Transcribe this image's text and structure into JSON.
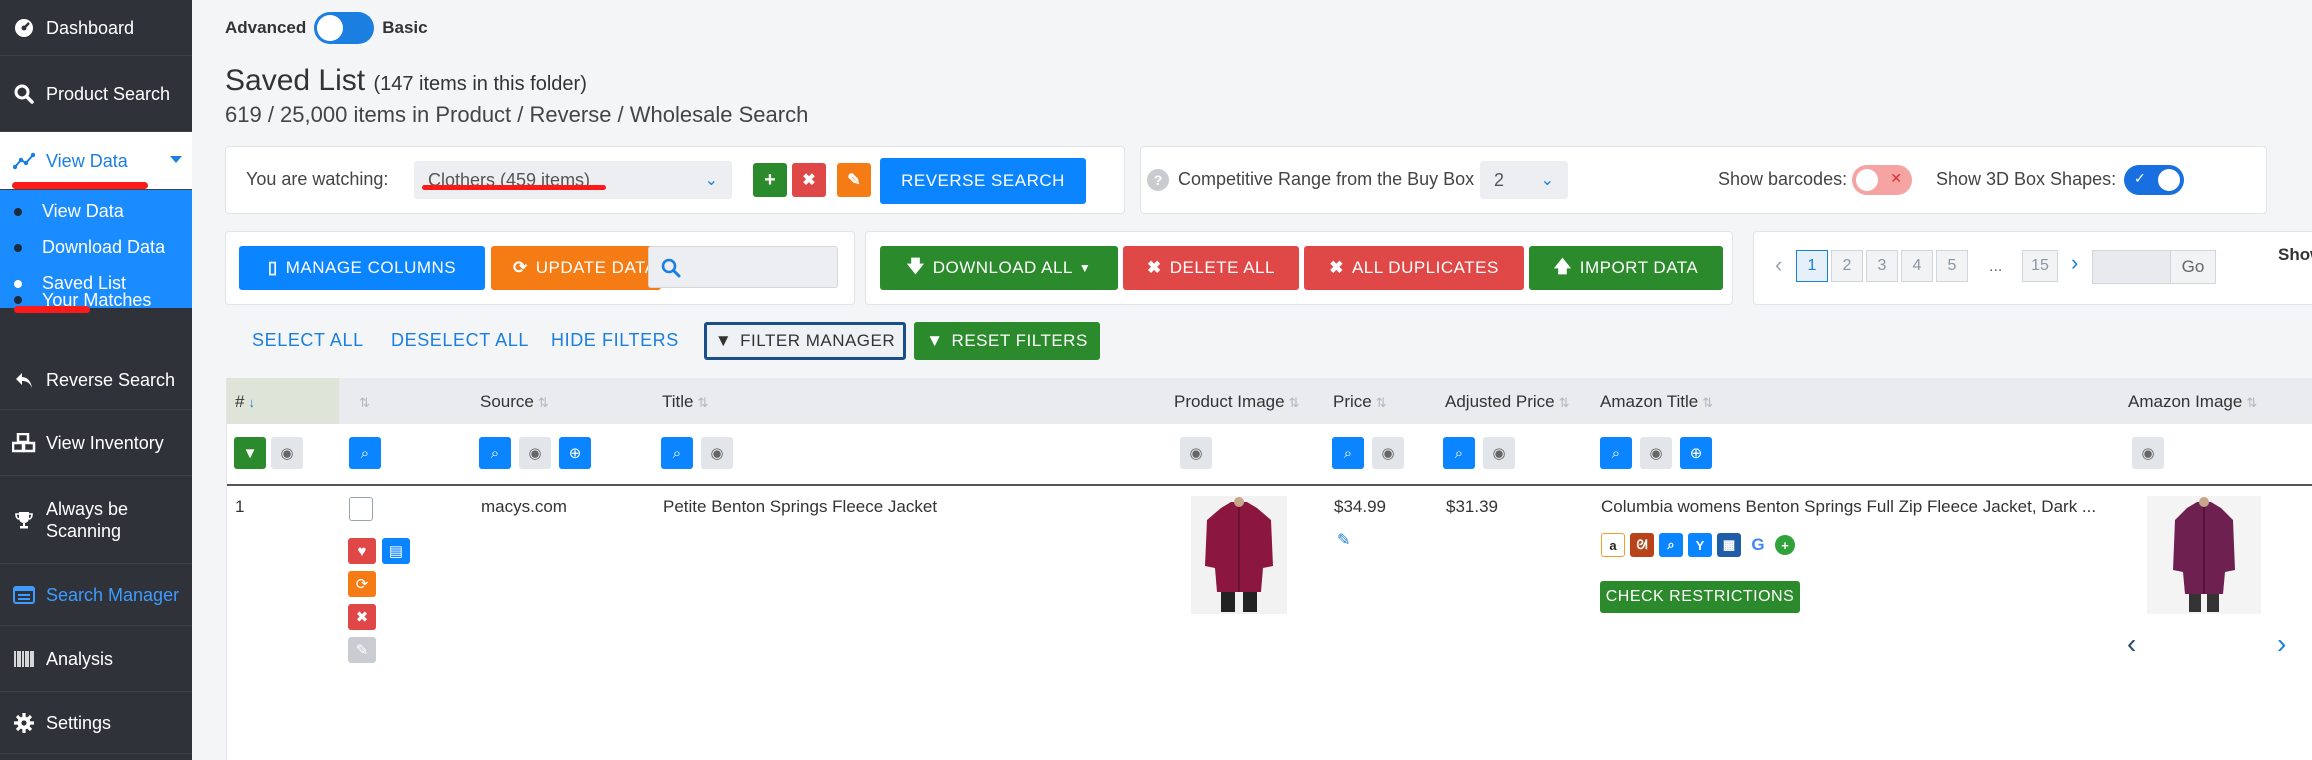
{
  "sidebar": {
    "items": [
      {
        "label": "Dashboard",
        "icon": "dashboard-icon"
      },
      {
        "label": "Product Search",
        "icon": "search-icon"
      },
      {
        "label": "View Data",
        "icon": "chart-line-icon"
      },
      {
        "label": "Reverse Search",
        "icon": "reply-icon"
      },
      {
        "label": "View Inventory",
        "icon": "boxes-icon"
      },
      {
        "label": "Always be Scanning",
        "icon": "trophy-icon"
      },
      {
        "label": "Search Manager",
        "icon": "list-window-icon"
      },
      {
        "label": "Analysis",
        "icon": "barcode-icon"
      },
      {
        "label": "Settings",
        "icon": "gear-icon"
      }
    ],
    "submenu": [
      "View Data",
      "Download Data",
      "Saved List",
      "Your Matches"
    ]
  },
  "mode_toggle": {
    "left": "Advanced",
    "right": "Basic"
  },
  "page": {
    "title": "Saved List",
    "folder_count": "(147 items in this folder)",
    "subtitle": "619 / 25,000 items in Product / Reverse / Wholesale Search"
  },
  "watch": {
    "label": "You are watching:",
    "selected": "Clothers (459 items)",
    "reverse_search": "REVERSE SEARCH"
  },
  "options": {
    "competitive_label": "Competitive Range from the Buy Box",
    "competitive_value": "2",
    "barcodes_label": "Show barcodes:",
    "box_shapes_label": "Show 3D Box Shapes:"
  },
  "toolbar": {
    "manage_columns": "MANAGE COLUMNS",
    "update_data": "UPDATE DATA",
    "download_all": "DOWNLOAD ALL",
    "delete_all": "DELETE ALL",
    "all_duplicates": "ALL DUPLICATES",
    "import_data": "IMPORT DATA"
  },
  "pagination": {
    "pages": [
      "1",
      "2",
      "3",
      "4",
      "5"
    ],
    "ellipsis": "...",
    "last": "15",
    "go": "Go",
    "show_label": "Show"
  },
  "filters": {
    "select_all": "SELECT ALL",
    "deselect_all": "DESELECT ALL",
    "hide_filters": "HIDE FILTERS",
    "filter_manager": "FILTER MANAGER",
    "reset_filters": "RESET FILTERS"
  },
  "table": {
    "columns": [
      "#",
      "",
      "Source",
      "Title",
      "Product Image",
      "Price",
      "Adjusted Price",
      "Amazon Title",
      "Amazon Image"
    ],
    "rows": [
      {
        "num": "1",
        "source": "macys.com",
        "title": "Petite Benton Springs Fleece Jacket",
        "price": "$34.99",
        "adjusted_price": "$31.39",
        "amazon_title": "Columbia womens Benton Springs Full Zip Fleece Jacket, Dark ...",
        "check_restrictions": "CHECK RESTRICTIONS"
      }
    ]
  },
  "colors": {
    "sidebar": "#2f3339",
    "accent_blue": "#0a84ff",
    "submenu_blue": "#1a8cff",
    "orange": "#f57c14",
    "green": "#2b8a2b",
    "red": "#e04848"
  }
}
